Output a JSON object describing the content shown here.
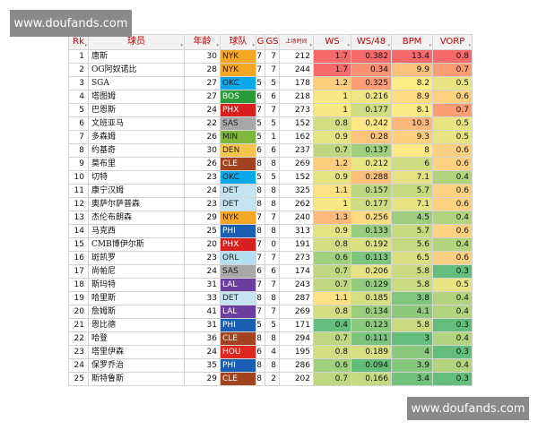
{
  "watermark": "www.doufands.com",
  "columns": [
    "Rk",
    "球员",
    "年龄",
    "球队",
    "G",
    "GS",
    "上场时间",
    "WS",
    "WS/48",
    "BPM",
    "VORP"
  ],
  "colors": {
    "teams": {
      "NYK": "#f5a623",
      "OKC": "#0aa8e8",
      "BOS": "#2b9a3a",
      "PHX": "#d8201e",
      "SAS": "#a8a8a8",
      "MIN": "#7fb83f",
      "DEN": "#f7c64b",
      "CLE": "#a1431e",
      "DET": "#c5e4f1",
      "PHI": "#1a5fb4",
      "LAL": "#6b3fa0",
      "ORL": "#b3dff0",
      "HOU": "#e0271f"
    },
    "scale": [
      "#63be7b",
      "#c6d980",
      "#ffeb84",
      "#fbaa77",
      "#f8696b"
    ]
  },
  "rows": [
    {
      "rk": "1",
      "name": "唐斯",
      "age": "30",
      "team": "NYK",
      "g": "7",
      "gs": "7",
      "min": "212",
      "ws": "1.7",
      "ws48": "0.382",
      "bpm": "13.4",
      "vorp": "0.8"
    },
    {
      "rk": "2",
      "name": "OG阿奴诺比",
      "age": "28",
      "team": "NYK",
      "g": "7",
      "gs": "7",
      "min": "244",
      "ws": "1.7",
      "ws48": "0.34",
      "bpm": "9.9",
      "vorp": "0.7"
    },
    {
      "rk": "3",
      "name": "SGA",
      "age": "27",
      "team": "OKC",
      "g": "5",
      "gs": "5",
      "min": "178",
      "ws": "1.2",
      "ws48": "0.325",
      "bpm": "8.2",
      "vorp": "0.5"
    },
    {
      "rk": "4",
      "name": "塔图姆",
      "age": "27",
      "team": "BOS",
      "g": "6",
      "gs": "6",
      "min": "218",
      "ws": "1",
      "ws48": "0.216",
      "bpm": "8.9",
      "vorp": "0.6"
    },
    {
      "rk": "5",
      "name": "巴恩斯",
      "age": "24",
      "team": "PHX",
      "g": "7",
      "gs": "7",
      "min": "273",
      "ws": "1",
      "ws48": "0.177",
      "bpm": "8.1",
      "vorp": "0.7"
    },
    {
      "rk": "6",
      "name": "文班亚马",
      "age": "22",
      "team": "SAS",
      "g": "5",
      "gs": "5",
      "min": "152",
      "ws": "0.8",
      "ws48": "0.242",
      "bpm": "10.3",
      "vorp": "0.5"
    },
    {
      "rk": "7",
      "name": "多森姆",
      "age": "26",
      "team": "MIN",
      "g": "5",
      "gs": "1",
      "min": "162",
      "ws": "0.9",
      "ws48": "0.28",
      "bpm": "9.3",
      "vorp": "0.5"
    },
    {
      "rk": "8",
      "name": "约基奇",
      "age": "30",
      "team": "DEN",
      "g": "6",
      "gs": "6",
      "min": "237",
      "ws": "0.7",
      "ws48": "0.137",
      "bpm": "8",
      "vorp": "0.6"
    },
    {
      "rk": "9",
      "name": "莫布里",
      "age": "26",
      "team": "CLE",
      "g": "8",
      "gs": "8",
      "min": "269",
      "ws": "1.2",
      "ws48": "0.212",
      "bpm": "6",
      "vorp": "0.6"
    },
    {
      "rk": "10",
      "name": "切特",
      "age": "23",
      "team": "OKC",
      "g": "5",
      "gs": "5",
      "min": "152",
      "ws": "0.9",
      "ws48": "0.288",
      "bpm": "7.1",
      "vorp": "0.4"
    },
    {
      "rk": "11",
      "name": "康宁汉姆",
      "age": "24",
      "team": "DET",
      "g": "8",
      "gs": "8",
      "min": "325",
      "ws": "1.1",
      "ws48": "0.157",
      "bpm": "5.7",
      "vorp": "0.6"
    },
    {
      "rk": "12",
      "name": "奥萨尔萨普森",
      "age": "23",
      "team": "DET",
      "g": "8",
      "gs": "8",
      "min": "262",
      "ws": "1",
      "ws48": "0.177",
      "bpm": "7.1",
      "vorp": "0.6"
    },
    {
      "rk": "13",
      "name": "杰伦布朗森",
      "age": "29",
      "team": "NYK",
      "g": "7",
      "gs": "7",
      "min": "240",
      "ws": "1.3",
      "ws48": "0.256",
      "bpm": "4.5",
      "vorp": "0.4"
    },
    {
      "rk": "14",
      "name": "马克西",
      "age": "25",
      "team": "PHI",
      "g": "8",
      "gs": "8",
      "min": "313",
      "ws": "0.9",
      "ws48": "0.133",
      "bpm": "5.7",
      "vorp": "0.6"
    },
    {
      "rk": "15",
      "name": "CMB博伊尔斯",
      "age": "20",
      "team": "PHX",
      "g": "7",
      "gs": "0",
      "min": "191",
      "ws": "0.8",
      "ws48": "0.192",
      "bpm": "5.6",
      "vorp": "0.4"
    },
    {
      "rk": "16",
      "name": "斑凯罗",
      "age": "23",
      "team": "ORL",
      "g": "7",
      "gs": "7",
      "min": "273",
      "ws": "0.6",
      "ws48": "0.113",
      "bpm": "6.5",
      "vorp": "0.6"
    },
    {
      "rk": "17",
      "name": "尚帕尼",
      "age": "24",
      "team": "SAS",
      "g": "6",
      "gs": "6",
      "min": "174",
      "ws": "0.7",
      "ws48": "0.206",
      "bpm": "5.8",
      "vorp": "0.3"
    },
    {
      "rk": "18",
      "name": "斯玛特",
      "age": "31",
      "team": "LAL",
      "g": "7",
      "gs": "7",
      "min": "243",
      "ws": "0.7",
      "ws48": "0.129",
      "bpm": "5.8",
      "vorp": "0.5"
    },
    {
      "rk": "19",
      "name": "哈里斯",
      "age": "33",
      "team": "DET",
      "g": "8",
      "gs": "8",
      "min": "287",
      "ws": "1.1",
      "ws48": "0.185",
      "bpm": "3.8",
      "vorp": "0.4"
    },
    {
      "rk": "20",
      "name": "詹姆斯",
      "age": "41",
      "team": "LAL",
      "g": "7",
      "gs": "7",
      "min": "269",
      "ws": "0.8",
      "ws48": "0.134",
      "bpm": "4.1",
      "vorp": "0.4"
    },
    {
      "rk": "21",
      "name": "恩比德",
      "age": "31",
      "team": "PHI",
      "g": "5",
      "gs": "5",
      "min": "171",
      "ws": "0.4",
      "ws48": "0.123",
      "bpm": "5.8",
      "vorp": "0.3"
    },
    {
      "rk": "22",
      "name": "哈登",
      "age": "36",
      "team": "CLE",
      "g": "8",
      "gs": "8",
      "min": "294",
      "ws": "0.7",
      "ws48": "0.111",
      "bpm": "3",
      "vorp": "0.4"
    },
    {
      "rk": "23",
      "name": "塔里伊森",
      "age": "24",
      "team": "HOU",
      "g": "6",
      "gs": "4",
      "min": "195",
      "ws": "0.8",
      "ws48": "0.189",
      "bpm": "4",
      "vorp": "0.3"
    },
    {
      "rk": "24",
      "name": "保罗乔治",
      "age": "35",
      "team": "PHI",
      "g": "8",
      "gs": "8",
      "min": "286",
      "ws": "0.6",
      "ws48": "0.094",
      "bpm": "3.9",
      "vorp": "0.4"
    },
    {
      "rk": "25",
      "name": "斯特鲁斯",
      "age": "29",
      "team": "CLE",
      "g": "8",
      "gs": "2",
      "min": "202",
      "ws": "0.7",
      "ws48": "0.166",
      "bpm": "3.4",
      "vorp": "0.3"
    }
  ]
}
